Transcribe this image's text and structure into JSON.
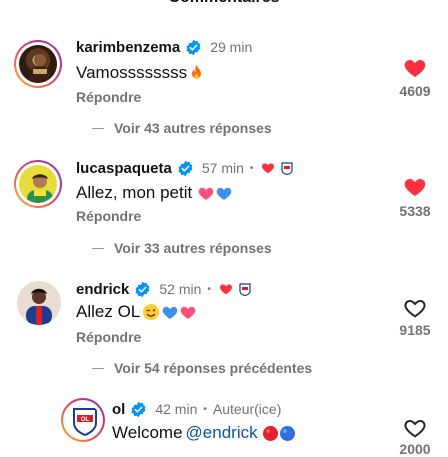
{
  "header": {
    "title": "Commentaires"
  },
  "comments": [
    {
      "username": "karimbenzema",
      "time": "29 min",
      "text": "Vamossssssss",
      "reply": "Répondre",
      "likes": "4609",
      "liked": true,
      "more_replies": "Voir 43 autres réponses"
    },
    {
      "username": "lucaspaqueta",
      "time": "57 min",
      "text": "Allez, mon petit",
      "reply": "Répondre",
      "likes": "5338",
      "liked": true,
      "more_replies": "Voir 33 autres réponses"
    },
    {
      "username": "endrick",
      "time": "52 min",
      "text": "Allez OL",
      "reply": "Répondre",
      "likes": "9185",
      "liked": false,
      "more_replies": "Voir 54 réponses précédentes"
    }
  ],
  "reply": {
    "username": "ol",
    "time": "42 min",
    "author_label": "Auteur(ice)",
    "text": "Welcome",
    "mention": "@endrick",
    "likes": "2000",
    "liked": false
  },
  "icons": {
    "verified": "verified-badge-icon",
    "heart_filled": "heart-filled-icon",
    "heart_outline": "heart-outline-icon",
    "fire": "fire-emoji-icon"
  },
  "colors": {
    "accent_red": "#ff3040",
    "verified_blue": "#0095f6",
    "secondary": "#737373",
    "mention": "#0a56a6"
  }
}
